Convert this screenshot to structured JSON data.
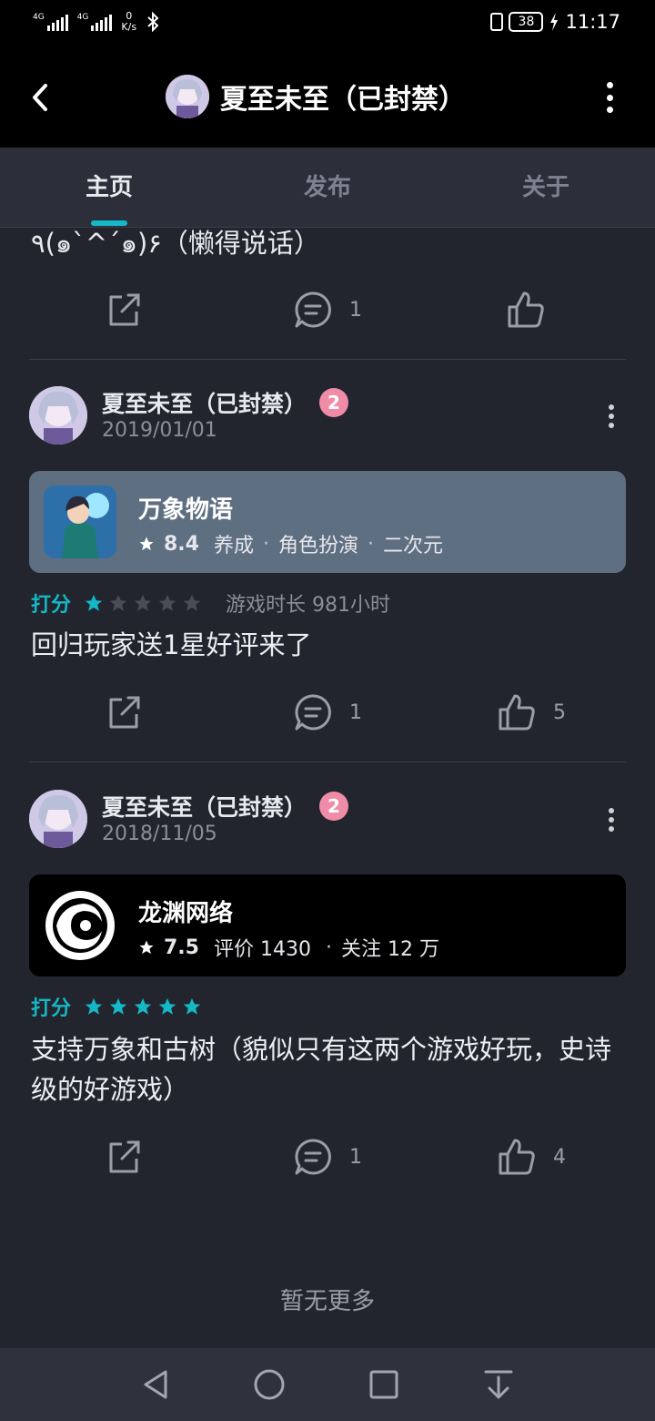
{
  "status_bar": {
    "sim1": "4G",
    "sim2": "4G",
    "net_speed_value": "0",
    "net_speed_unit": "K/s",
    "battery": "38",
    "time": "11:17"
  },
  "header": {
    "title": "夏至未至（已封禁）"
  },
  "tabs": [
    {
      "label": "主页",
      "active": true
    },
    {
      "label": "发布",
      "active": false
    },
    {
      "label": "关于",
      "active": false
    }
  ],
  "partial_post": {
    "text": "٩(๑`^´๑)۶（懒得说话）",
    "comments": "1",
    "likes": ""
  },
  "posts": [
    {
      "author": "夏至未至（已封禁）",
      "level": "2",
      "date": "2019/01/01",
      "card": {
        "name": "万象物语",
        "score": "8.4",
        "tags": [
          "养成",
          "角色扮演",
          "二次元"
        ],
        "bg_color": "#5f6f82"
      },
      "rating_label": "打分",
      "rating": 1,
      "rating_max": 5,
      "playtime": "游戏时长 981小时",
      "text": "回归玩家送1星好评来了",
      "comments": "1",
      "likes": "5"
    },
    {
      "author": "夏至未至（已封禁）",
      "level": "2",
      "date": "2018/11/05",
      "card": {
        "name": "龙渊网络",
        "score": "7.5",
        "reviews": "评价 1430",
        "followers": "关注 12 万",
        "bg_color": "#000000"
      },
      "rating_label": "打分",
      "rating": 5,
      "rating_max": 5,
      "text": "支持万象和古树（貌似只有这两个游戏好玩，史诗级的好游戏）",
      "comments": "1",
      "likes": "4"
    }
  ],
  "footer": {
    "no_more": "暂无更多"
  },
  "colors": {
    "accent": "#14b8c6",
    "background": "#23252e",
    "tab_bar": "#2c2f3a",
    "level_badge": "#f08ca8"
  }
}
